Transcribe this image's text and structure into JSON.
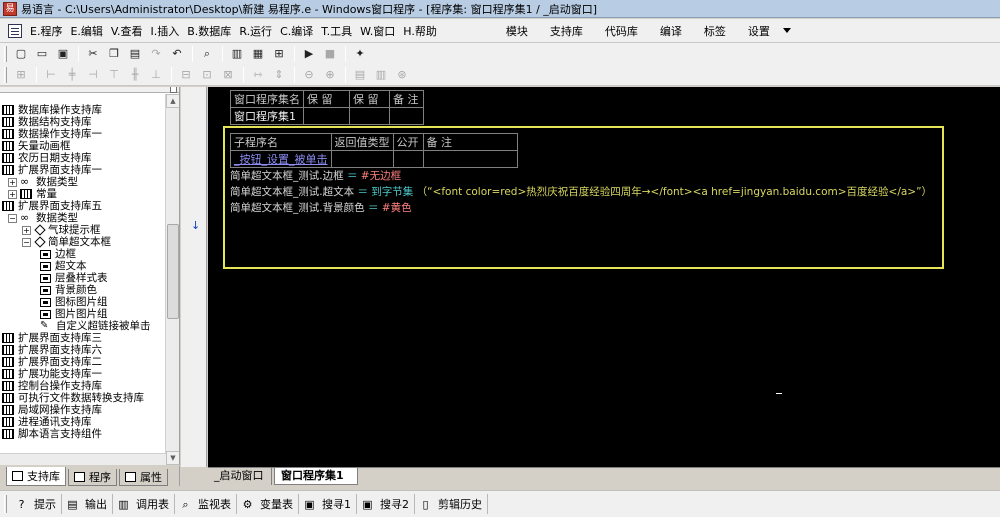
{
  "window": {
    "title": "易语言 - C:\\Users\\Administrator\\Desktop\\新建 易程序.e - Windows窗口程序 - [程序集: 窗口程序集1 / _启动窗口]"
  },
  "menu": {
    "items": [
      "E.程序",
      "E.编辑",
      "V.查看",
      "I.插入",
      "B.数据库",
      "R.运行",
      "C.编译",
      "T.工具",
      "W.窗口",
      "H.帮助"
    ],
    "right_items": [
      "模块",
      "支持库",
      "代码库",
      "编译",
      "标签",
      "设置"
    ]
  },
  "toolbar": {
    "buttons": [
      "new-icon",
      "open-icon",
      "save-icon",
      "cut-icon",
      "copy-icon",
      "paste-icon",
      "redo-icon",
      "undo-icon",
      "find-icon",
      "layout-icon",
      "window-icon",
      "table-icon",
      "run-icon",
      "stop-icon",
      "tool-icon"
    ]
  },
  "left_panel": {
    "tree": [
      {
        "label": "数据库操作支持库",
        "type": "lib",
        "indent": 0
      },
      {
        "label": "数据结构支持库",
        "type": "lib",
        "indent": 0
      },
      {
        "label": "数据操作支持库一",
        "type": "lib",
        "indent": 0
      },
      {
        "label": "矢量动画框",
        "type": "lib",
        "indent": 0
      },
      {
        "label": "农历日期支持库",
        "type": "lib",
        "indent": 0
      },
      {
        "label": "扩展界面支持库一",
        "type": "lib",
        "indent": 0
      },
      {
        "label": "数据类型",
        "type": "group-collapsed",
        "indent": 1
      },
      {
        "label": "常量",
        "type": "const",
        "indent": 1
      },
      {
        "label": "扩展界面支持库五",
        "type": "lib",
        "indent": 0
      },
      {
        "label": "数据类型",
        "type": "group-expanded",
        "indent": 1
      },
      {
        "label": "气球提示框",
        "type": "class-collapsed",
        "indent": 2
      },
      {
        "label": "简单超文本框",
        "type": "class-expanded",
        "indent": 2
      },
      {
        "label": "边框",
        "type": "prop",
        "indent": 3
      },
      {
        "label": "超文本",
        "type": "prop",
        "indent": 3
      },
      {
        "label": "层叠样式表",
        "type": "prop",
        "indent": 3
      },
      {
        "label": "背景颜色",
        "type": "prop",
        "indent": 3
      },
      {
        "label": "图标图片组",
        "type": "prop",
        "indent": 3
      },
      {
        "label": "图片图片组",
        "type": "prop",
        "indent": 3
      },
      {
        "label": "自定义超链接被单击",
        "type": "event",
        "indent": 3
      },
      {
        "label": "扩展界面支持库三",
        "type": "lib",
        "indent": 0
      },
      {
        "label": "扩展界面支持库六",
        "type": "lib",
        "indent": 0
      },
      {
        "label": "扩展界面支持库二",
        "type": "lib",
        "indent": 0
      },
      {
        "label": "扩展功能支持库一",
        "type": "lib",
        "indent": 0
      },
      {
        "label": "控制台操作支持库",
        "type": "lib",
        "indent": 0
      },
      {
        "label": "可执行文件数据转换支持库",
        "type": "lib",
        "indent": 0
      },
      {
        "label": "局域网操作支持库",
        "type": "lib",
        "indent": 0
      },
      {
        "label": "进程通讯支持库",
        "type": "lib",
        "indent": 0
      },
      {
        "label": "脚本语言支持组件",
        "type": "lib",
        "indent": 0
      }
    ],
    "tabs": [
      "支持库",
      "程序",
      "属性"
    ]
  },
  "editor": {
    "assembly_table": {
      "headers": [
        "窗口程序集名",
        "保 留",
        "保 留",
        "备 注"
      ],
      "values": [
        "窗口程序集1",
        "",
        "",
        ""
      ]
    },
    "sub_table": {
      "headers": [
        "子程序名",
        "返回值类型",
        "公开",
        "备 注"
      ],
      "values": [
        "_按钮_设置_被单击",
        "",
        "",
        ""
      ]
    },
    "code_lines": [
      {
        "object": "简单超文本框_测试.边框",
        "op": "＝",
        "value": "#无边框"
      },
      {
        "object": "简单超文本框_测试.超文本",
        "op": "＝",
        "fn": "到字节集",
        "arg": "（“<font color=red>热烈庆祝百度经验四周年→</font><a href=jingyan.baidu.com>百度经验</a>”）"
      },
      {
        "object": "简单超文本框_测试.背景颜色",
        "op": "＝",
        "value": "#黄色"
      }
    ],
    "tabs": [
      "_启动窗口",
      "窗口程序集1"
    ]
  },
  "bottom_bar": {
    "items": [
      "提示",
      "输出",
      "调用表",
      "监视表",
      "变量表",
      "搜寻1",
      "搜寻2",
      "剪辑历史"
    ]
  },
  "colors": {
    "editor_bg": "#000000",
    "highlight_box": "#e4e456",
    "constant": "#ff8080",
    "keyword": "#50c8c8",
    "string": "#d8d860",
    "link": "#8c8cf4"
  }
}
